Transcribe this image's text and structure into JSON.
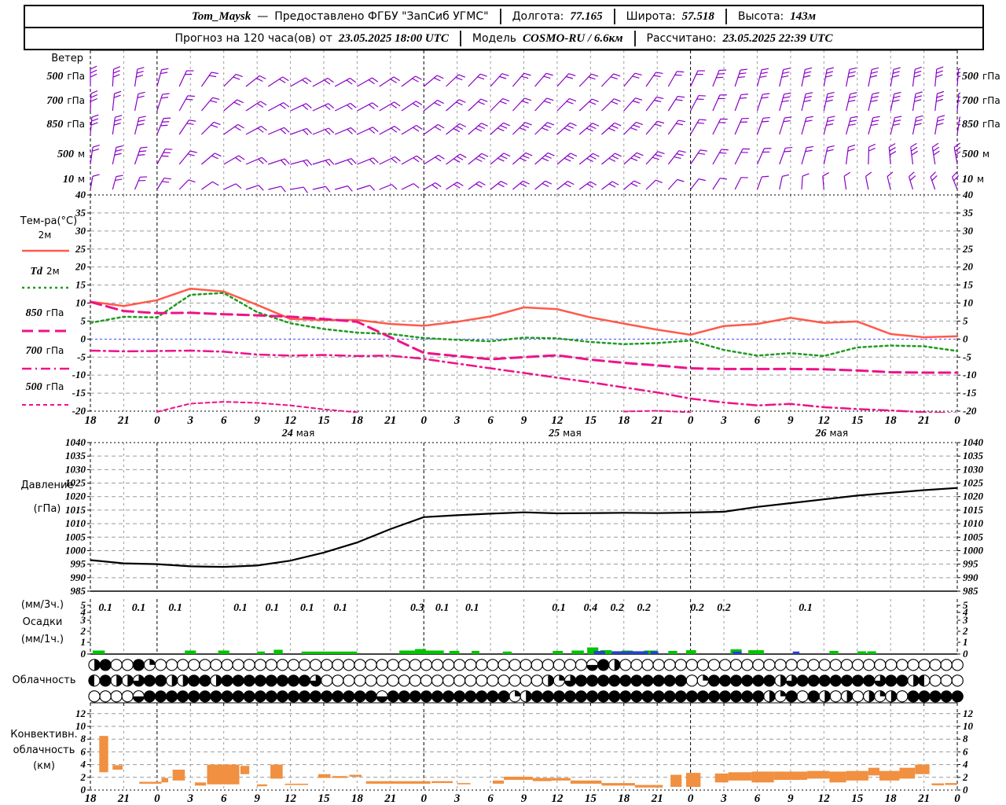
{
  "header": {
    "row1": [
      {
        "t": "Tom_Maysk",
        "k": "val"
      },
      {
        "t": "—",
        "k": "lbl"
      },
      {
        "t": "Предоставлено ФГБУ \"ЗапСиб УГМС\"",
        "k": "lbl"
      },
      {
        "k": "sep"
      },
      {
        "t": "Долгота:",
        "k": "lbl"
      },
      {
        "t": "77.165",
        "k": "val"
      },
      {
        "k": "sep"
      },
      {
        "t": "Широта:",
        "k": "lbl"
      },
      {
        "t": "57.518",
        "k": "val"
      },
      {
        "k": "sep"
      },
      {
        "t": "Высота:",
        "k": "lbl"
      },
      {
        "t": "143м",
        "k": "val"
      }
    ],
    "row2": [
      {
        "t": "Прогноз на 120 часа(ов) от",
        "k": "lbl"
      },
      {
        "t": "23.05.2025 18:00 UTC",
        "k": "val"
      },
      {
        "k": "sep"
      },
      {
        "t": "Модель",
        "k": "lbl"
      },
      {
        "t": "COSMO-RU / 6.6км",
        "k": "val"
      },
      {
        "k": "sep"
      },
      {
        "t": "Рассчитано:",
        "k": "lbl"
      },
      {
        "t": "23.05.2025 22:39 UTC",
        "k": "val"
      }
    ]
  },
  "colors": {
    "barb": "#8a00c8",
    "temp_2m": "#ff5a4b",
    "td": "#1e9b1e",
    "mag": "#ee1289",
    "zero_line": "#4646ff",
    "pressure": "#000000",
    "precip_3h": "#00c400",
    "precip_1h": "#2244cc",
    "conv": "#f09040",
    "grid": "#9a9a9a"
  },
  "panels": {
    "wind": {
      "title": "Ветер",
      "levels": [
        "500 гПа",
        "700 гПа",
        "850 гПа",
        "500 м",
        "10 м"
      ]
    },
    "temp": {
      "title": "Тем-ра(°C)"
    },
    "pressure": {
      "l1": "Давление",
      "l2": "(гПа)"
    },
    "precip": {
      "l1": "(мм/3ч.)",
      "l2": "Осадки",
      "l3": "(мм/1ч.)"
    },
    "cloud": {
      "title": "Облачность"
    },
    "conv": {
      "l1": "Конвективн.",
      "l2": "облачность",
      "l3": "(км)"
    }
  },
  "axis": {
    "hours": [
      "18",
      "21",
      "0",
      "3",
      "6",
      "9",
      "12",
      "15",
      "18",
      "21",
      "0",
      "3",
      "6",
      "9",
      "12",
      "15",
      "18",
      "21",
      "0",
      "3",
      "6",
      "9",
      "12",
      "15",
      "18",
      "21",
      "0"
    ],
    "days": [
      {
        "i": 6,
        "num": "24",
        "word": "мая"
      },
      {
        "i": 14,
        "num": "25",
        "word": "мая"
      },
      {
        "i": 22,
        "num": "26",
        "word": "мая"
      }
    ]
  },
  "chart_data": [
    {
      "id": "wind",
      "type": "wind-barbs",
      "title": "Ветер",
      "levels": [
        {
          "label": "500 гПа",
          "dirs": [
            0,
            5,
            15,
            30,
            45,
            55,
            60,
            62,
            60,
            55,
            50,
            45,
            42,
            40,
            42,
            45,
            40,
            32,
            25,
            20,
            15,
            12,
            10,
            12,
            10,
            6,
            4
          ],
          "spd": [
            3,
            3,
            2,
            2,
            2,
            2,
            2,
            2,
            2,
            2,
            2,
            2,
            2,
            2,
            2,
            2,
            2,
            2,
            2,
            3,
            3,
            3,
            3,
            3,
            3,
            3,
            3
          ]
        },
        {
          "label": "700 гПа",
          "dirs": [
            2,
            8,
            18,
            35,
            50,
            60,
            65,
            65,
            62,
            58,
            52,
            48,
            45,
            42,
            45,
            48,
            42,
            35,
            28,
            22,
            18,
            14,
            12,
            14,
            12,
            8,
            5
          ],
          "spd": [
            3,
            2,
            2,
            2,
            2,
            2,
            2,
            2,
            2,
            2,
            2,
            2,
            2,
            2,
            2,
            2,
            2,
            2,
            2,
            2,
            2,
            3,
            3,
            3,
            3,
            3,
            3
          ]
        },
        {
          "label": "850 гПа",
          "dirs": [
            5,
            10,
            22,
            40,
            55,
            65,
            70,
            68,
            65,
            60,
            55,
            50,
            48,
            45,
            48,
            50,
            45,
            38,
            30,
            25,
            20,
            16,
            14,
            16,
            14,
            10,
            8
          ],
          "spd": [
            3,
            3,
            3,
            2,
            2,
            2,
            2,
            2,
            2,
            2,
            2,
            3,
            3,
            3,
            3,
            3,
            3,
            2,
            2,
            2,
            2,
            2,
            3,
            3,
            3,
            3,
            3
          ]
        },
        {
          "label": "500 м",
          "dirs": [
            8,
            14,
            28,
            45,
            60,
            70,
            75,
            72,
            68,
            62,
            58,
            52,
            50,
            48,
            50,
            52,
            48,
            40,
            34,
            28,
            24,
            18,
            12,
            5,
            -5,
            -8,
            -10
          ],
          "spd": [
            2,
            3,
            3,
            2,
            2,
            2,
            2,
            2,
            2,
            2,
            2,
            3,
            3,
            3,
            3,
            3,
            3,
            3,
            2,
            2,
            2,
            2,
            2,
            2,
            3,
            3,
            3
          ]
        },
        {
          "label": "10 м",
          "dirs": [
            10,
            18,
            32,
            50,
            65,
            75,
            80,
            76,
            72,
            66,
            60,
            55,
            52,
            50,
            52,
            55,
            50,
            44,
            38,
            30,
            20,
            8,
            -5,
            -10,
            -14,
            -18,
            -22
          ],
          "spd": [
            1,
            2,
            2,
            1,
            1,
            1,
            1,
            1,
            1,
            1,
            2,
            2,
            2,
            2,
            2,
            2,
            2,
            1,
            1,
            1,
            1,
            1,
            1,
            1,
            1,
            2,
            2
          ]
        }
      ]
    },
    {
      "id": "temp",
      "type": "line",
      "title": "Тем-ра(°C)",
      "ylim": [
        -20,
        40
      ],
      "ytick_step": 5,
      "series": [
        {
          "name": "2м",
          "color": "#ff5a4b",
          "style": "solid",
          "values": [
            10.4,
            9.2,
            10.8,
            14.0,
            13.2,
            9.5,
            5.6,
            5.3,
            5.3,
            4.2,
            3.7,
            4.8,
            6.3,
            8.8,
            8.3,
            6.0,
            4.3,
            2.6,
            1.2,
            3.6,
            4.2,
            5.9,
            4.5,
            4.9,
            1.4,
            0.5,
            0.8
          ]
        },
        {
          "name": "Td 2м",
          "color": "#1e9b1e",
          "style": "dotted",
          "values": [
            4.5,
            6.2,
            6.0,
            12.3,
            12.8,
            7.5,
            4.4,
            2.8,
            1.8,
            1.4,
            0.3,
            -0.2,
            -0.6,
            0.4,
            0.2,
            -0.8,
            -1.4,
            -1.1,
            -0.4,
            -3.0,
            -4.6,
            -3.9,
            -4.7,
            -2.3,
            -1.8,
            -2.0,
            -3.3
          ]
        },
        {
          "name": "850 гПа",
          "color": "#ee1289",
          "style": "longdash",
          "values": [
            10.3,
            7.8,
            7.2,
            7.3,
            6.9,
            6.6,
            6.2,
            5.6,
            4.8,
            0.5,
            -3.8,
            -4.7,
            -5.6,
            -5.0,
            -4.5,
            -5.7,
            -6.6,
            -7.3,
            -8.1,
            -8.3,
            -8.3,
            -8.3,
            -8.4,
            -8.7,
            -9.2,
            -9.3,
            -9.3
          ]
        },
        {
          "name": "700 гПа",
          "color": "#ee1289",
          "style": "dashdot",
          "values": [
            -3.2,
            -3.4,
            -3.3,
            -3.2,
            -3.5,
            -4.3,
            -4.6,
            -4.4,
            -4.7,
            -4.6,
            -5.5,
            -6.8,
            -8.1,
            -9.4,
            -10.7,
            -12.0,
            -13.4,
            -14.8,
            -16.5,
            -17.6,
            -18.4,
            -18.0,
            -18.9,
            -19.4,
            -19.8,
            -20.3,
            -20.6
          ]
        },
        {
          "name": "500 гПа",
          "color": "#ee1289",
          "style": "shortdash",
          "values": [
            null,
            null,
            -20.2,
            -17.9,
            -17.4,
            -17.7,
            -18.4,
            -19.5,
            -20.3,
            null,
            null,
            null,
            null,
            null,
            null,
            null,
            -20.1,
            -19.9,
            -20.3,
            null,
            null,
            null,
            null,
            null,
            null,
            null,
            null
          ]
        }
      ]
    },
    {
      "id": "pressure",
      "type": "line",
      "title": "Давление (гПа)",
      "ylim": [
        985,
        1040
      ],
      "ytick_step": 5,
      "values": [
        996.5,
        995.3,
        995.0,
        994.2,
        994.0,
        994.5,
        996.3,
        999.3,
        1003.0,
        1008.0,
        1012.4,
        1013.1,
        1013.7,
        1014.2,
        1013.8,
        1013.9,
        1014.0,
        1013.9,
        1014.1,
        1014.4,
        1016.2,
        1017.6,
        1019.0,
        1020.4,
        1021.4,
        1022.4,
        1023.2
      ]
    },
    {
      "id": "precip",
      "type": "bar",
      "title": "Осадки (мм/3ч., мм/1ч.)",
      "ylim": [
        0,
        6
      ],
      "labels": [
        {
          "i": 0.45,
          "v": "0.1"
        },
        {
          "i": 1.45,
          "v": "0.1"
        },
        {
          "i": 2.55,
          "v": "0.1"
        },
        {
          "i": 4.5,
          "v": "0.1"
        },
        {
          "i": 5.45,
          "v": "0.1"
        },
        {
          "i": 6.5,
          "v": "0.1"
        },
        {
          "i": 7.5,
          "v": "0.1"
        },
        {
          "i": 9.8,
          "v": "0.3"
        },
        {
          "i": 10.55,
          "v": "0.1"
        },
        {
          "i": 11.45,
          "v": "0.1"
        },
        {
          "i": 14.05,
          "v": "0.1"
        },
        {
          "i": 15.0,
          "v": "0.4"
        },
        {
          "i": 15.8,
          "v": "0.2"
        },
        {
          "i": 16.6,
          "v": "0.2"
        },
        {
          "i": 18.2,
          "v": "0.2"
        },
        {
          "i": 19.0,
          "v": "0.2"
        },
        {
          "i": 21.45,
          "v": "0.1"
        }
      ],
      "green_bars": [
        [
          0.2,
          1.3,
          0.1
        ],
        [
          8.5,
          9.5,
          0.1
        ],
        [
          11.5,
          12.5,
          0.1
        ],
        [
          15.0,
          15.7,
          0.05
        ],
        [
          16.5,
          17.3,
          0.15
        ],
        [
          19.0,
          24.0,
          0.05
        ],
        [
          27.8,
          29.2,
          0.1
        ],
        [
          29.2,
          30.2,
          0.2
        ],
        [
          30.2,
          31.8,
          0.1
        ],
        [
          32.3,
          33.2,
          0.08
        ],
        [
          34.3,
          35.0,
          0.08
        ],
        [
          37.1,
          37.9,
          0.05
        ],
        [
          41.6,
          42.5,
          0.08
        ],
        [
          43.3,
          44.4,
          0.1
        ],
        [
          44.7,
          45.7,
          0.35
        ],
        [
          45.9,
          46.9,
          0.12
        ],
        [
          47.8,
          48.8,
          0.1
        ],
        [
          49.8,
          51.0,
          0.1
        ],
        [
          52.0,
          52.8,
          0.08
        ],
        [
          53.6,
          54.5,
          0.12
        ],
        [
          57.6,
          58.6,
          0.18
        ],
        [
          59.2,
          60.6,
          0.12
        ],
        [
          66.5,
          67.3,
          0.08
        ],
        [
          69.0,
          69.8,
          0.06
        ],
        [
          69.9,
          70.7,
          0.06
        ]
      ],
      "blue_bars": [
        [
          45.3,
          46.3,
          0.12
        ],
        [
          46.9,
          50.2,
          0.1
        ],
        [
          50.4,
          51.1,
          0.1
        ],
        [
          57.8,
          58.6,
          0.08
        ],
        [
          63.2,
          63.8,
          0.08
        ]
      ]
    },
    {
      "id": "cloud",
      "type": "heatmap",
      "title": "Облачность",
      "rows": [
        "◑●○○●◔○○○○○○○○○○○○○○○○○○○○○○○○○○○○○○○○○○○○○○○◒●◑○○○○○○○○○○○○○○○○○○○○○○○○○○○○○○○",
        "◐●◑◑◕●●◑◑●●◑●●●●●●●●◕○○○○○○○○○○○○○○○○○○○○◑◔◕●●●●●●●●●●○◔●●●●●●◑◕●●●●●●●◕●●◑◐○○○",
        "○○○○◒●●●●●●●●●●●●●●●●●●●●●◒●●●●●●●●●●●◔◑●●●●●●●●●●●●●●●●●●●●●◑◔●○●◑○◑○◑◔◑○●●●●●"
      ]
    },
    {
      "id": "conv",
      "type": "bar-range",
      "title": "Конвективн. облачность (км)",
      "ylim": [
        0,
        13
      ],
      "segments": [
        [
          0.8,
          1.6,
          2.8,
          8.5
        ],
        [
          2.0,
          2.9,
          3.2,
          3.9
        ],
        [
          4.4,
          6.4,
          1.0,
          1.3
        ],
        [
          6.4,
          7.0,
          1.2,
          1.9
        ],
        [
          7.4,
          8.5,
          1.5,
          3.2
        ],
        [
          9.4,
          10.4,
          0.7,
          1.2
        ],
        [
          10.5,
          13.4,
          0.9,
          4.0
        ],
        [
          13.5,
          14.3,
          2.5,
          3.8
        ],
        [
          15.0,
          15.9,
          0.6,
          0.9
        ],
        [
          16.2,
          17.3,
          1.8,
          4.0
        ],
        [
          17.5,
          19.6,
          0.8,
          1.0
        ],
        [
          20.5,
          21.6,
          1.9,
          2.5
        ],
        [
          21.8,
          23.1,
          1.9,
          2.2
        ],
        [
          23.3,
          24.4,
          2.1,
          2.4
        ],
        [
          24.8,
          30.6,
          1.0,
          1.4
        ],
        [
          30.7,
          32.6,
          1.1,
          1.4
        ],
        [
          33.0,
          34.2,
          0.9,
          1.1
        ],
        [
          36.2,
          37.2,
          1.0,
          1.5
        ],
        [
          37.2,
          39.8,
          1.6,
          2.1
        ],
        [
          39.8,
          41.5,
          1.4,
          1.9
        ],
        [
          41.5,
          43.2,
          1.5,
          1.9
        ],
        [
          43.2,
          46.0,
          1.0,
          1.5
        ],
        [
          46.0,
          49.0,
          0.7,
          1.1
        ],
        [
          49.0,
          51.5,
          0.4,
          0.8
        ],
        [
          52.2,
          53.2,
          0.5,
          2.4
        ],
        [
          53.6,
          54.9,
          0.5,
          2.7
        ],
        [
          56.2,
          57.4,
          1.2,
          2.6
        ],
        [
          57.4,
          59.5,
          1.5,
          2.8
        ],
        [
          59.5,
          61.5,
          1.2,
          2.9
        ],
        [
          61.5,
          64.5,
          1.6,
          2.9
        ],
        [
          64.5,
          66.5,
          1.8,
          3.0
        ],
        [
          66.5,
          68.0,
          1.2,
          2.9
        ],
        [
          68.0,
          70.0,
          1.5,
          3.0
        ],
        [
          70.0,
          71.0,
          2.3,
          3.5
        ],
        [
          71.0,
          72.8,
          1.5,
          3.0
        ],
        [
          72.8,
          74.2,
          1.8,
          3.5
        ],
        [
          74.2,
          75.5,
          2.5,
          4.0
        ],
        [
          75.7,
          76.8,
          0.75,
          1.05
        ],
        [
          76.9,
          78.0,
          0.8,
          1.1
        ]
      ]
    }
  ]
}
